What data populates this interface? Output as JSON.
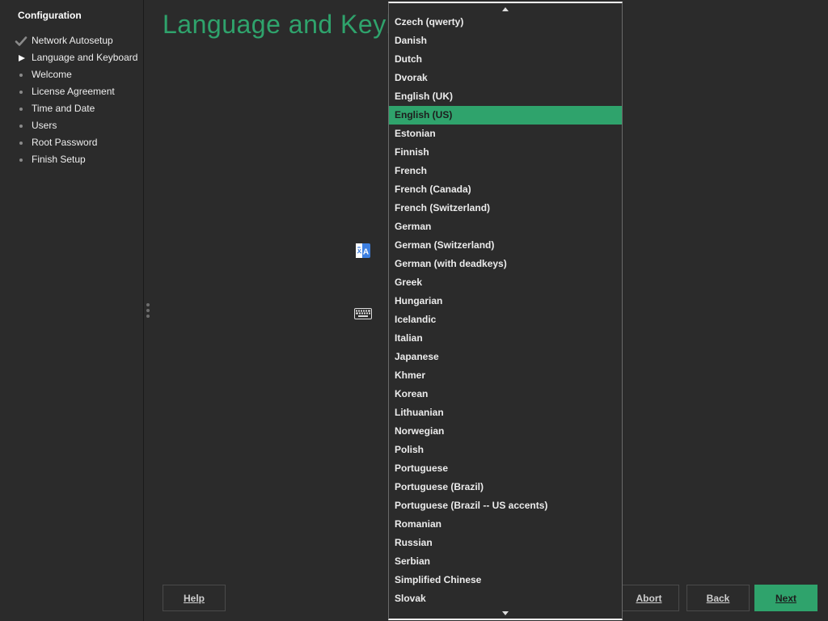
{
  "sidebar": {
    "title": "Configuration",
    "steps": [
      {
        "label": "Network Autosetup",
        "state": "done"
      },
      {
        "label": "Language and Keyboard",
        "state": "current"
      },
      {
        "label": "Welcome",
        "state": "pending"
      },
      {
        "label": "License Agreement",
        "state": "pending"
      },
      {
        "label": "Time and Date",
        "state": "pending"
      },
      {
        "label": "Users",
        "state": "pending"
      },
      {
        "label": "Root Password",
        "state": "pending"
      },
      {
        "label": "Finish Setup",
        "state": "pending"
      }
    ]
  },
  "main": {
    "title": "Language and Keyb"
  },
  "buttons": {
    "help": "Help",
    "abort": "Abort",
    "back": "Back",
    "next": "Next"
  },
  "dropdown": {
    "selected": "English (US)",
    "options": [
      "Czech (qwerty)",
      "Danish",
      "Dutch",
      "Dvorak",
      "English (UK)",
      "English (US)",
      "Estonian",
      "Finnish",
      "French",
      "French (Canada)",
      "French (Switzerland)",
      "German",
      "German (Switzerland)",
      "German (with deadkeys)",
      "Greek",
      "Hungarian",
      "Icelandic",
      "Italian",
      "Japanese",
      "Khmer",
      "Korean",
      "Lithuanian",
      "Norwegian",
      "Polish",
      "Portuguese",
      "Portuguese (Brazil)",
      "Portuguese (Brazil -- US accents)",
      "Romanian",
      "Russian",
      "Serbian",
      "Simplified Chinese",
      "Slovak"
    ]
  },
  "icons": {
    "language": "language-icon",
    "keyboard": "keyboard-icon",
    "check": "checkmark-icon",
    "current": "play-triangle-icon",
    "pending": "dot-icon"
  },
  "colors": {
    "accent": "#2fa36c",
    "background": "#2b2b2b",
    "text": "#eeeeee"
  }
}
